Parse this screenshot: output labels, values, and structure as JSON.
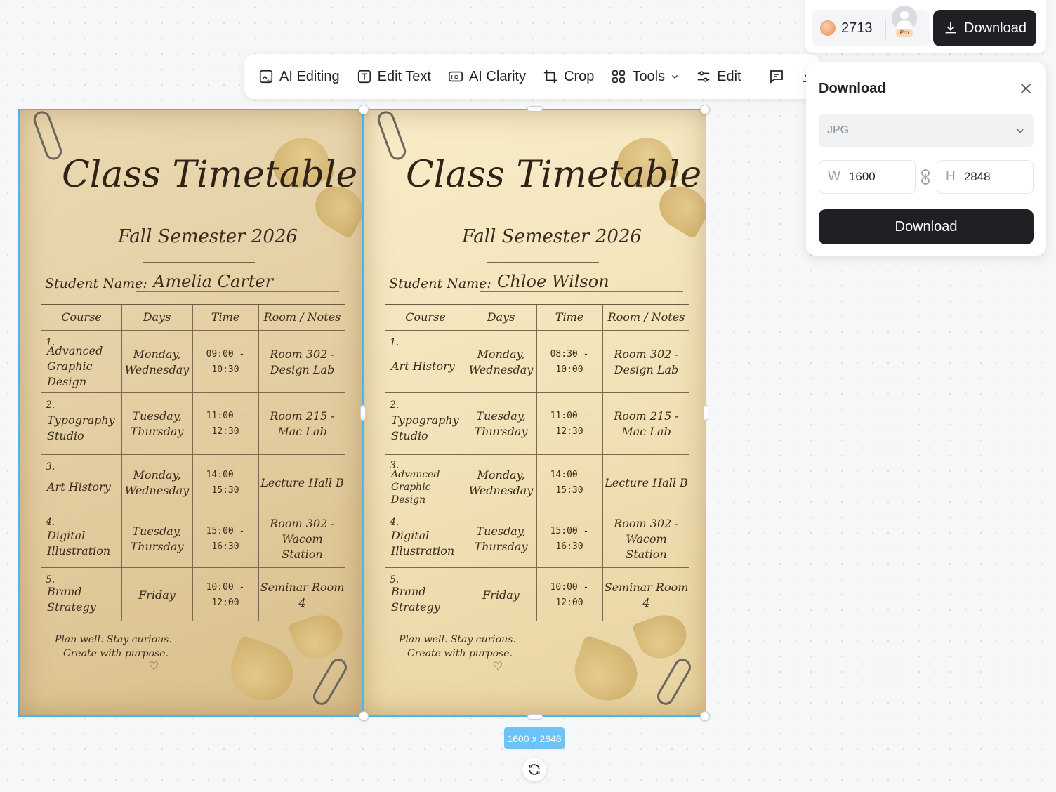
{
  "toolbar": {
    "items": [
      {
        "label": "AI Editing",
        "icon": "ai-editing-icon"
      },
      {
        "label": "Edit Text",
        "icon": "edit-text-icon"
      },
      {
        "label": "AI Clarity",
        "icon": "hd-icon"
      },
      {
        "label": "Crop",
        "icon": "crop-icon"
      },
      {
        "label": "Tools",
        "icon": "grid-icon"
      },
      {
        "label": "Edit",
        "icon": "sliders-icon"
      }
    ],
    "comment_icon": "comment-icon",
    "download_icon": "download-icon"
  },
  "account": {
    "credits": "2713",
    "badge": "Pro",
    "download_label": "Download"
  },
  "download_panel": {
    "title": "Download",
    "format": "JPG",
    "width_label": "W",
    "width_value": "1600",
    "height_label": "H",
    "height_value": "2848",
    "download_label": "Download"
  },
  "canvas": {
    "dimension_badge": "1600 x 2848"
  },
  "sheets": [
    {
      "title": "Class Timetable",
      "subtitle": "Fall Semester 2026",
      "student_label": "Student Name:",
      "student_name": "Amelia Carter",
      "headers": [
        "Course",
        "Days",
        "Time",
        "Room / Notes"
      ],
      "rows": [
        {
          "num": "1.",
          "course": "Advanced Graphic Design",
          "days": "Monday, Wednesday",
          "time": "09:00 - 10:30",
          "room": "Room 302 - Design Lab"
        },
        {
          "num": "2.",
          "course": "Typography Studio",
          "days": "Tuesday, Thursday",
          "time": "11:00 - 12:30",
          "room": "Room 215 - Mac Lab"
        },
        {
          "num": "3.",
          "course": "Art History",
          "days": "Monday, Wednesday",
          "time": "14:00 - 15:30",
          "room": "Lecture Hall B"
        },
        {
          "num": "4.",
          "course": "Digital Illustration",
          "days": "Tuesday, Thursday",
          "time": "15:00 - 16:30",
          "room": "Room 302 - Wacom Station"
        },
        {
          "num": "5.",
          "course": "Brand Strategy",
          "days": "Friday",
          "time": "10:00 - 12:00",
          "room": "Seminar Room 4"
        }
      ],
      "footer_line1": "Plan well. Stay curious.",
      "footer_line2": "Create with purpose."
    },
    {
      "title": "Class Timetable",
      "subtitle": "Fall Semester 2026",
      "student_label": "Student Name:",
      "student_name": "Chloe Wilson",
      "headers": [
        "Course",
        "Days",
        "Time",
        "Room / Notes"
      ],
      "rows": [
        {
          "num": "1.",
          "course": "Art History",
          "days": "Monday, Wednesday",
          "time": "08:30 - 10:00",
          "room": "Room 302 - Design Lab"
        },
        {
          "num": "2.",
          "course": "Typography Studio",
          "days": "Tuesday, Thursday",
          "time": "11:00 - 12:30",
          "room": "Room 215 - Mac Lab"
        },
        {
          "num": "3.",
          "course": "Advanced Graphic Design",
          "days": "Monday, Wednesday",
          "time": "14:00 - 15:30",
          "room": "Lecture Hall B"
        },
        {
          "num": "4.",
          "course": "Digital Illustration",
          "days": "Tuesday, Thursday",
          "time": "15:00 - 16:30",
          "room": "Room 302 - Wacom Station"
        },
        {
          "num": "5.",
          "course": "Brand Strategy",
          "days": "Friday",
          "time": "10:00 - 12:00",
          "room": "Seminar Room 4"
        }
      ],
      "footer_line1": "Plan well. Stay curious.",
      "footer_line2": "Create with purpose."
    }
  ]
}
